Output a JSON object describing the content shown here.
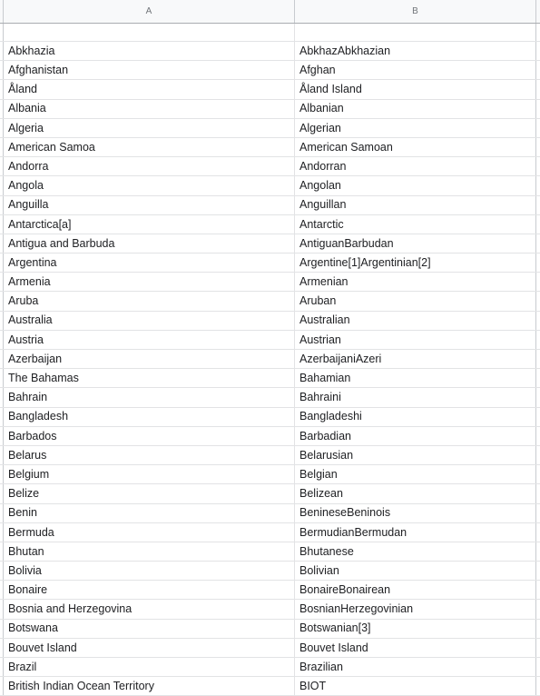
{
  "app": {
    "type": "spreadsheet"
  },
  "colors": {
    "header_bg": "#f8f9fa",
    "header_text": "#71757a",
    "grid_line": "#e2e3e5",
    "cell_text": "#202124",
    "sheet_bg": "#ffffff"
  },
  "columns": [
    {
      "id": "A",
      "label": "A"
    },
    {
      "id": "B",
      "label": "B"
    }
  ],
  "blank_row": {
    "a": "",
    "b": ""
  },
  "rows": [
    {
      "a": "Abkhazia",
      "b": "AbkhazAbkhazian"
    },
    {
      "a": "Afghanistan",
      "b": "Afghan"
    },
    {
      "a": "Åland",
      "b": "Åland Island"
    },
    {
      "a": "Albania",
      "b": "Albanian"
    },
    {
      "a": "Algeria",
      "b": "Algerian"
    },
    {
      "a": "American Samoa",
      "b": "American Samoan"
    },
    {
      "a": "Andorra",
      "b": "Andorran"
    },
    {
      "a": "Angola",
      "b": "Angolan"
    },
    {
      "a": "Anguilla",
      "b": "Anguillan"
    },
    {
      "a": "Antarctica[a]",
      "b": "Antarctic"
    },
    {
      "a": "Antigua and Barbuda",
      "b": "AntiguanBarbudan"
    },
    {
      "a": "Argentina",
      "b": "Argentine[1]Argentinian[2]"
    },
    {
      "a": "Armenia",
      "b": "Armenian"
    },
    {
      "a": "Aruba",
      "b": "Aruban"
    },
    {
      "a": "Australia",
      "b": "Australian"
    },
    {
      "a": "Austria",
      "b": "Austrian"
    },
    {
      "a": "Azerbaijan",
      "b": "AzerbaijaniAzeri"
    },
    {
      "a": "The Bahamas",
      "b": "Bahamian"
    },
    {
      "a": "Bahrain",
      "b": "Bahraini"
    },
    {
      "a": "Bangladesh",
      "b": "Bangladeshi"
    },
    {
      "a": "Barbados",
      "b": "Barbadian"
    },
    {
      "a": "Belarus",
      "b": "Belarusian"
    },
    {
      "a": "Belgium",
      "b": "Belgian"
    },
    {
      "a": "Belize",
      "b": "Belizean"
    },
    {
      "a": "Benin",
      "b": "BenineseBeninois"
    },
    {
      "a": "Bermuda",
      "b": "BermudianBermudan"
    },
    {
      "a": "Bhutan",
      "b": "Bhutanese"
    },
    {
      "a": "Bolivia",
      "b": "Bolivian"
    },
    {
      "a": "Bonaire",
      "b": "BonaireBonairean"
    },
    {
      "a": "Bosnia and Herzegovina",
      "b": "BosnianHerzegovinian"
    },
    {
      "a": "Botswana",
      "b": "Botswanian[3]"
    },
    {
      "a": "Bouvet Island",
      "b": "Bouvet Island"
    },
    {
      "a": "Brazil",
      "b": "Brazilian"
    },
    {
      "a": "British Indian Ocean Territory",
      "b": "BIOT"
    }
  ]
}
